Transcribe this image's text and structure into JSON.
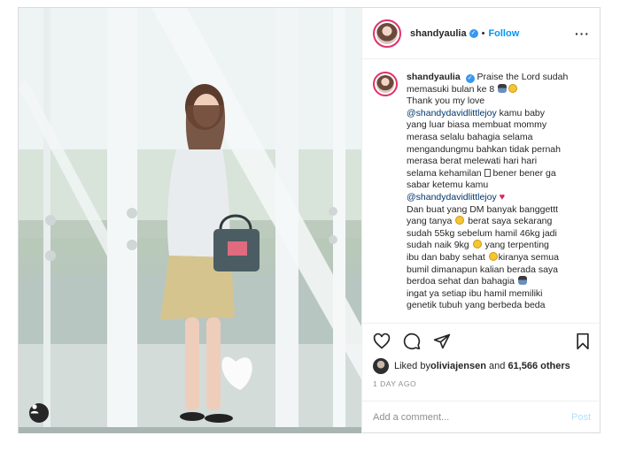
{
  "username": "shandyaulia",
  "verified_mark": "✓",
  "header": {
    "dot": "•",
    "follow_label": "Follow",
    "more_label": "···"
  },
  "caption": {
    "lines": [
      [
        "Praise the Lord sudah"
      ],
      [
        "memasuki bulan ke 8"
      ],
      [
        "Thank you my love"
      ],
      [
        "@shandydavidlittlejoy",
        " kamu baby"
      ],
      [
        "yang luar biasa membuat mommy"
      ],
      [
        "merasa selalu bahagia selama"
      ],
      [
        "mengandungmu bahkan tidak pernah"
      ],
      [
        "merasa berat melewati hari hari"
      ],
      [
        "selama kehamilan",
        " bener bener ga"
      ],
      [
        "sabar ketemu kamu"
      ],
      [
        "@shandydavidlittlejoy"
      ],
      [
        "Dan buat yang DM banyak banggettt"
      ],
      [
        "yang tanya",
        " berat saya sekarang"
      ],
      [
        "sudah 55kg sebelum hamil 46kg jadi"
      ],
      [
        "sudah naik 9kg",
        " yang terpenting"
      ],
      [
        "ibu dan baby sehat",
        "kiranya semua"
      ],
      [
        "bumil dimanapun kalian berada saya"
      ],
      [
        "berdoa sehat dan bahagia"
      ],
      [
        "ingat ya setiap ibu hamil memiliki"
      ],
      [
        "genetik tubuh yang berbeda beda"
      ]
    ]
  },
  "icons": {
    "heart": "heart-outline-icon",
    "comment": "comment-icon",
    "share": "share-icon",
    "bookmark": "bookmark-icon",
    "user_tag": "user-tag-icon"
  },
  "likes": {
    "prefix": "Liked by ",
    "user": "oliviajensen",
    "middle": " and ",
    "count": "61,566 others"
  },
  "date": "1 DAY AGO",
  "comment_box": {
    "placeholder": "Add a comment...",
    "post_label": "Post"
  },
  "colors": {
    "link_blue": "#0095f6",
    "mention": "#00376b",
    "heart_red": "#e0245e",
    "border": "#dbdbdb"
  }
}
